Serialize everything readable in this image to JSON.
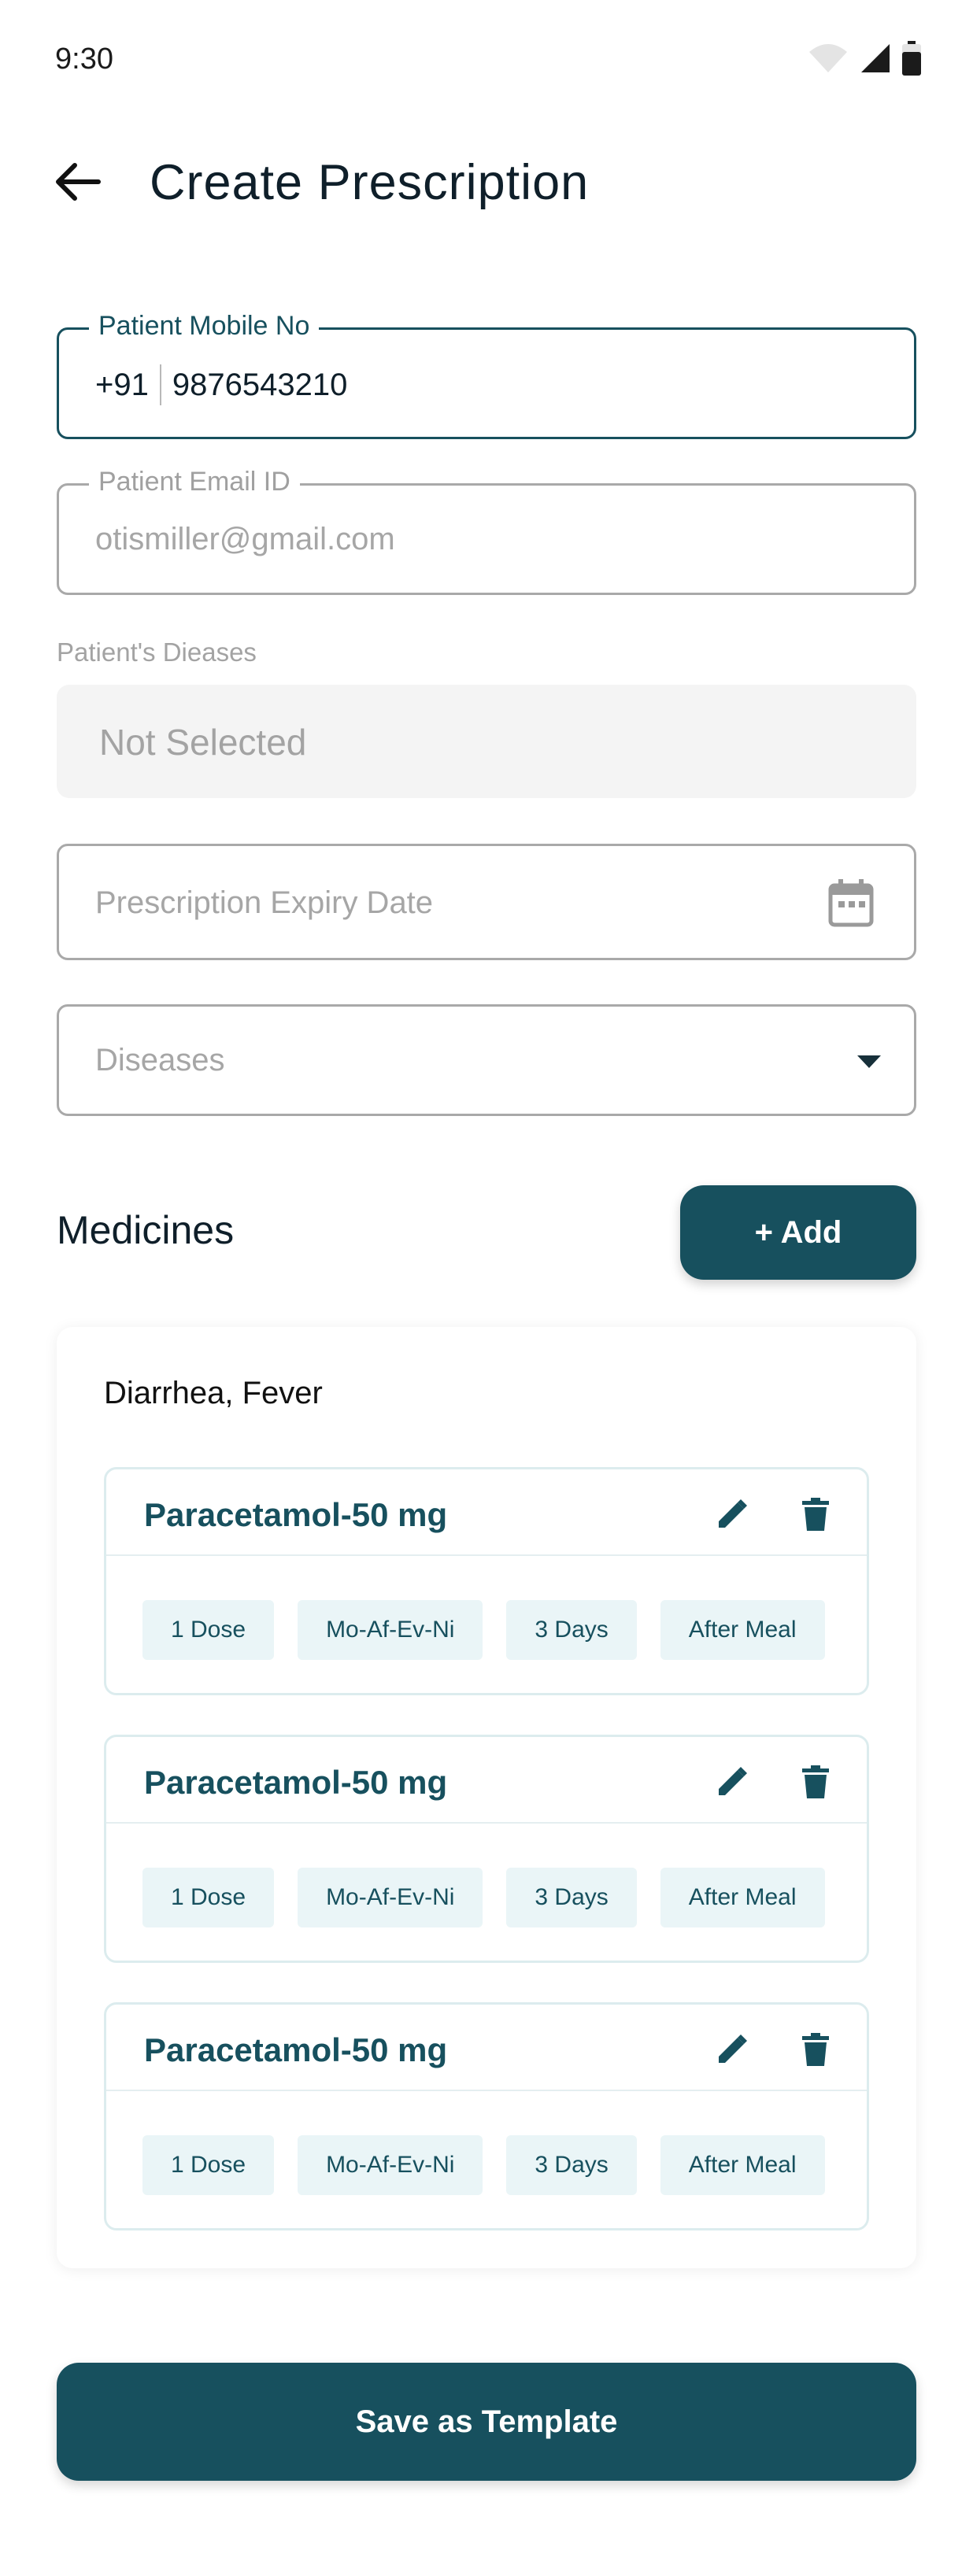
{
  "status_bar": {
    "time": "9:30"
  },
  "header": {
    "title": "Create Prescription"
  },
  "form": {
    "mobile": {
      "label": "Patient Mobile No",
      "prefix": "+91",
      "value": "9876543210"
    },
    "email": {
      "label": "Patient Email ID",
      "placeholder": "otismiller@gmail.com"
    },
    "diseases_label": "Patient's Dieases",
    "diseases_value": "Not Selected",
    "expiry": {
      "placeholder": "Prescription Expiry Date"
    },
    "diseases_dropdown": {
      "placeholder": "Diseases"
    }
  },
  "medicines": {
    "title": "Medicines",
    "add_label": "+ Add",
    "card_title": "Diarrhea, Fever",
    "items": [
      {
        "name": "Paracetamol-50 mg",
        "chips": [
          "1 Dose",
          "Mo-Af-Ev-Ni",
          "3 Days",
          "After Meal"
        ]
      },
      {
        "name": "Paracetamol-50 mg",
        "chips": [
          "1 Dose",
          "Mo-Af-Ev-Ni",
          "3 Days",
          "After Meal"
        ]
      },
      {
        "name": "Paracetamol-50 mg",
        "chips": [
          "1 Dose",
          "Mo-Af-Ev-Ni",
          "3 Days",
          "After Meal"
        ]
      }
    ]
  },
  "save_label": "Save as Template",
  "colors": {
    "primary": "#17505e",
    "chip_bg": "#eaf5f7",
    "field_border": "#a9a9a9"
  }
}
